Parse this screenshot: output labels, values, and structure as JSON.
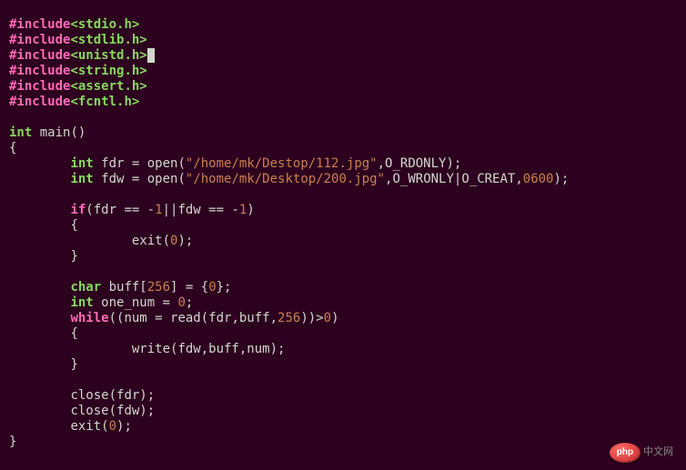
{
  "code": {
    "includes": [
      "<stdio.h>",
      "<stdlib.h>",
      "<unistd.h>",
      "<string.h>",
      "<assert.h>",
      "<fcntl.h>"
    ],
    "include_kw": "#include",
    "main_sig_type": "int",
    "main_sig_name": "main()",
    "line_fdr_type": "int",
    "line_fdr_var": " fdr = open(",
    "line_fdr_str": "\"/home/mk/Destop/112.jpg\"",
    "line_fdr_tail": ",O_RDONLY);",
    "line_fdw_type": "int",
    "line_fdw_var": " fdw = open(",
    "line_fdw_str": "\"/home/mk/Desktop/200.jpg\"",
    "line_fdw_tail1": ",O_WRONLY|O_CREAT,",
    "line_fdw_num": "0600",
    "line_fdw_tail2": ");",
    "if_kw": "if",
    "if_cond_a": "(fdr == -",
    "if_cond_n1": "1",
    "if_cond_mid": "||fdw == -",
    "if_cond_n2": "1",
    "if_cond_end": ")",
    "brace_open": "{",
    "brace_close": "}",
    "exit_call": "exit(",
    "exit_num": "0",
    "exit_tail": ");",
    "char_kw": "char",
    "char_decl_a": " buff[",
    "char_decl_n": "256",
    "char_decl_b": "] = {",
    "char_decl_z": "0",
    "char_decl_c": "};",
    "int_kw": "int",
    "one_num_decl": " one_num = ",
    "one_num_val": "0",
    "one_num_tail": ";",
    "while_kw": "while",
    "while_a": "((num = read(fdr,buff,",
    "while_n": "256",
    "while_b": "))>",
    "while_z": "0",
    "while_c": ")",
    "write_call": "write(fdw,buff,num);",
    "close_fdr": "close(fdr);",
    "close_fdw": "close(fdw);"
  },
  "badge": {
    "logo": "php",
    "text": "中文网"
  }
}
